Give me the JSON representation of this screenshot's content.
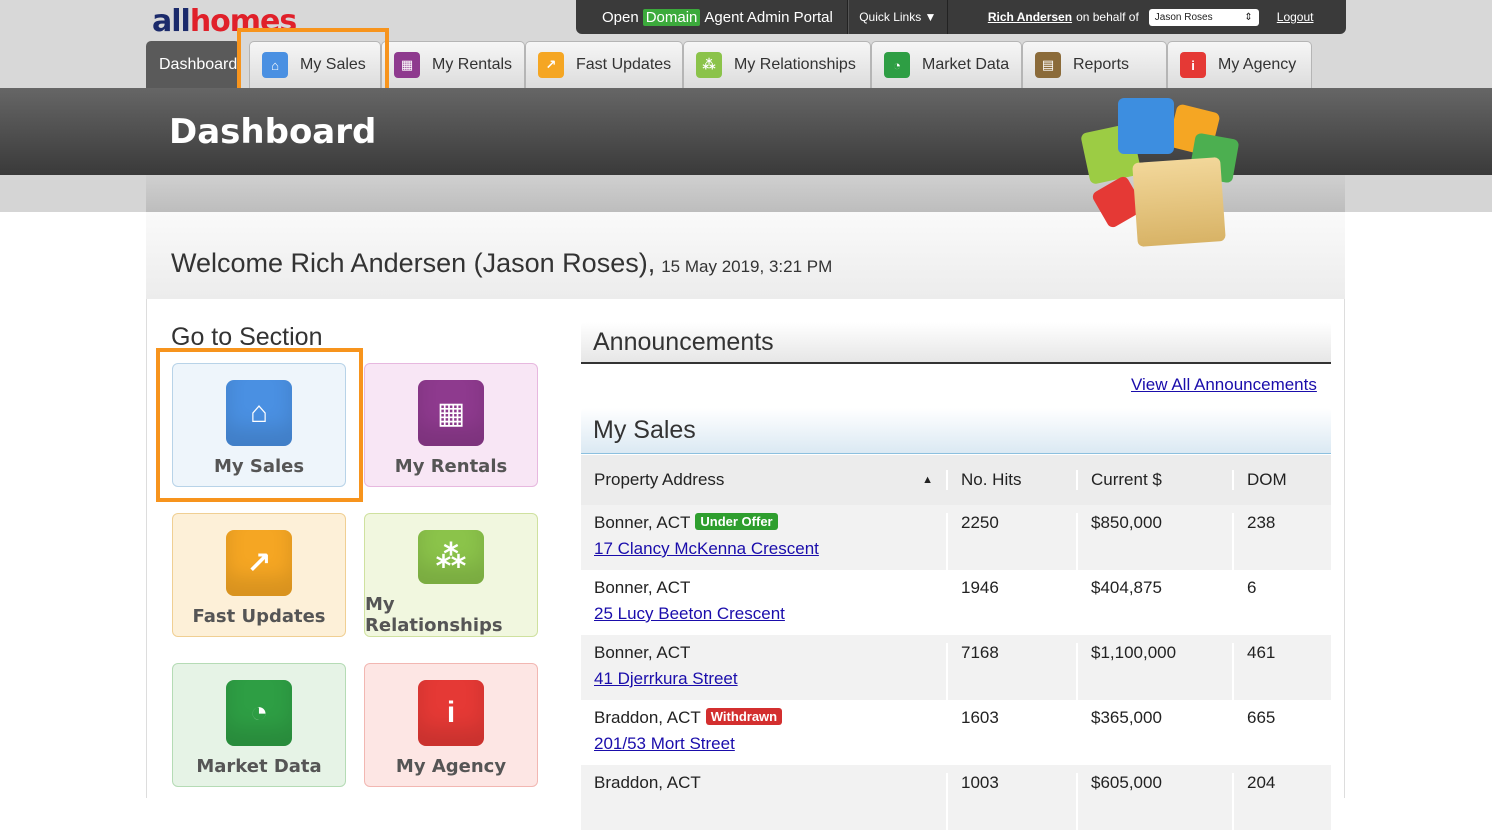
{
  "logo": {
    "part1": "all",
    "part2": "homes"
  },
  "topbar": {
    "portal_open": "Open",
    "portal_domain": "Domain",
    "portal_rest": "Agent Admin Portal",
    "quick_links": "Quick Links ▼",
    "user_name": "Rich Andersen",
    "on_behalf": "on behalf of",
    "behalf_select": "Jason Roses",
    "logout": "Logout"
  },
  "tabs": [
    {
      "label": "Dashboard"
    },
    {
      "label": "My Sales",
      "color": "#4a90e2"
    },
    {
      "label": "My Rentals",
      "color": "#8e3a8e"
    },
    {
      "label": "Fast Updates",
      "color": "#f5a623"
    },
    {
      "label": "My Relationships",
      "color": "#8bc34a"
    },
    {
      "label": "Market Data",
      "color": "#2e9e44"
    },
    {
      "label": "Reports",
      "color": "#8b6b3a"
    },
    {
      "label": "My Agency",
      "color": "#e53935"
    }
  ],
  "page_title": "Dashboard",
  "welcome": {
    "text": "Welcome Rich Andersen (Jason Roses),",
    "datetime": "15 May 2019, 3:21 PM"
  },
  "goto_title": "Go to Section",
  "sections": [
    {
      "label": "My Sales"
    },
    {
      "label": "My Rentals"
    },
    {
      "label": "Fast Updates"
    },
    {
      "label": "My Relationships"
    },
    {
      "label": "Market Data"
    },
    {
      "label": "My Agency"
    }
  ],
  "announcements": {
    "title": "Announcements",
    "view_all": "View All Announcements"
  },
  "my_sales": {
    "title": "My Sales",
    "columns": [
      "Property Address",
      "No. Hits",
      "Current $",
      "DOM"
    ],
    "sort_indicator": "▲",
    "rows": [
      {
        "suburb": "Bonner, ACT",
        "badge": "Under Offer",
        "address": "17 Clancy McKenna Crescent",
        "hits": "2250",
        "price": "$850,000",
        "dom": "238"
      },
      {
        "suburb": "Bonner, ACT",
        "badge": "",
        "address": "25 Lucy Beeton Crescent",
        "hits": "1946",
        "price": "$404,875",
        "dom": "6"
      },
      {
        "suburb": "Bonner, ACT",
        "badge": "",
        "address": "41 Djerrkura Street",
        "hits": "7168",
        "price": "$1,100,000",
        "dom": "461"
      },
      {
        "suburb": "Braddon, ACT",
        "badge": "Withdrawn",
        "address": "201/53 Mort Street",
        "hits": "1603",
        "price": "$365,000",
        "dom": "665"
      },
      {
        "suburb": "Braddon, ACT",
        "badge": "",
        "address": "",
        "hits": "1003",
        "price": "$605,000",
        "dom": "204"
      }
    ]
  }
}
